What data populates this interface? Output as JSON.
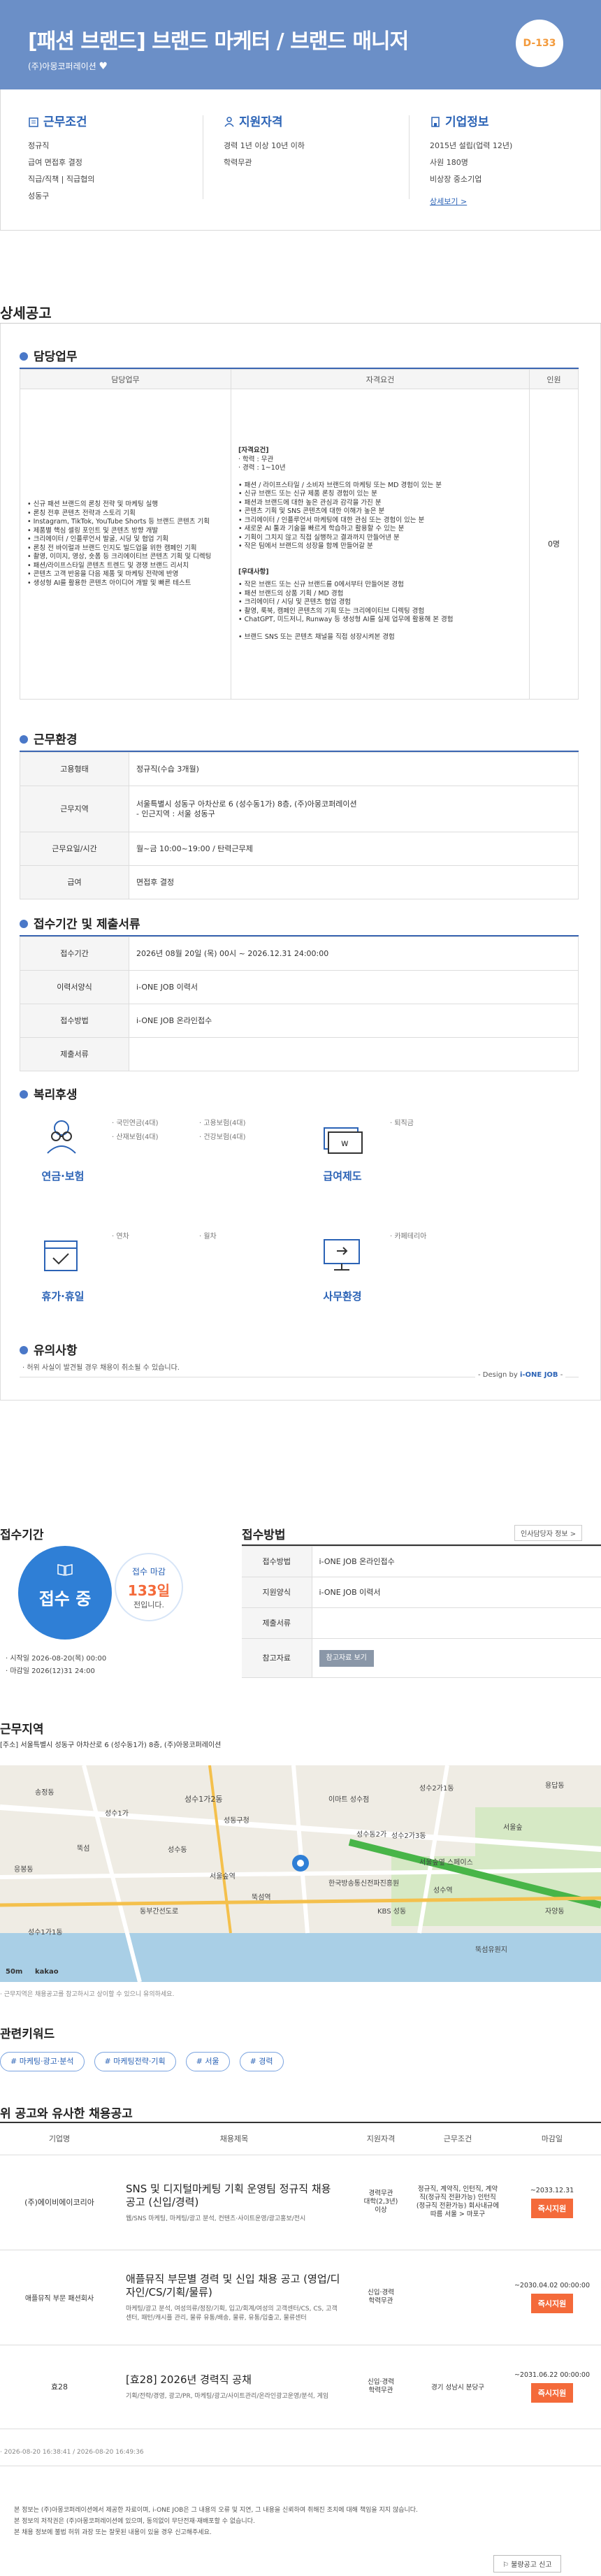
{
  "header": {
    "title": "[패션 브랜드] 브랜드 마케터 / 브랜드 매니저",
    "company": "(주)아몽코퍼레이션",
    "dday": "D-133"
  },
  "info": {
    "conditions": {
      "title": "근무조건",
      "lines": [
        "정규직",
        "급여 면접후 결정",
        "직급/직책 | 직급협의",
        "성동구"
      ]
    },
    "qualifications": {
      "title": "지원자격",
      "lines": [
        "경력 1년 이상 10년 이하",
        "학력무관"
      ]
    },
    "company": {
      "title": "기업정보",
      "lines": [
        "2015년 설립(업력 12년)",
        "사원 180명",
        "비상장 중소기업"
      ],
      "link": "상세보기 >"
    }
  },
  "detail_title": "상세공고",
  "duties": {
    "heading": "담당업무",
    "columns": [
      "담당업무",
      "자격요건",
      "인원"
    ],
    "task_lines": [
      "• 신규 패션 브랜드의 론칭 전략 및 마케팅 실행",
      "• 론칭 전후 콘텐츠 전략과 스토리 기획",
      "• Instagram, TikTok, YouTube Shorts 등 브랜드 콘텐츠 기획",
      "• 제품별 핵심 셀링 포인트 및 콘텐츠 방향 개발",
      "• 크리에이터 / 인플루언서 발굴, 시딩 및 협업 기획",
      "• 론칭 전 바이럴과 브랜드 인지도 빌드업을 위한 캠페인 기획",
      "• 촬영, 이미지, 영상, 숏폼 등 크리에이티브 콘텐츠 기획 및 디렉팅",
      "• 패션/라이프스타일 콘텐츠 트렌드 및 경쟁 브랜드 리서치",
      "• 콘텐츠 고객 반응을 다음 제품 및 마케팅 전략에 반영",
      "• 생성형 AI를 활용한 콘텐츠 아이디어 개발 및 빠른 테스트"
    ],
    "req_title": "[자격요건]",
    "req_lines": [
      "· 학력 : 무관",
      "· 경력 : 1~10년",
      "",
      "• 패션 / 라이프스타일 / 소비자 브랜드의 마케팅 또는 MD 경험이 있는 분",
      "• 신규 브랜드 또는 신규 제품 론칭 경험이 있는 분",
      "• 패션과 브랜드에 대한 높은 관심과 감각을 가진 분",
      "• 콘텐츠 기획 및 SNS 콘텐츠에 대한 이해가 높은 분",
      "• 크리에이터 / 인플루언서 마케팅에 대한 관심 또는 경험이 있는 분",
      "• 새로운 AI 툴과 기술을 빠르게 학습하고 활용할 수 있는 분",
      "• 기획이 그치지 않고 직접 실행하고 결과까지 만들어낸 분",
      "• 작은 팀에서 브랜드의 성장을 함께 만들어갈 분"
    ],
    "pref_title": "[우대사항]",
    "pref_lines": [
      "• 작은 브랜드 또는 신규 브랜드를 0에서부터 만들어본 경험",
      "• 패션 브랜드의 상품 기획 / MD 경험",
      "• 크리에이터 / 시딩 및 콘텐츠 협업 경험",
      "• 촬영, 룩북, 캠페인 콘텐츠의 기획 또는 크리에이티브 디렉팅 경험",
      "• ChatGPT, 미드저니, Runway 등 생성형 AI를 실제 업무에 활용해 본 경험",
      "",
      "• 브랜드 SNS 또는 콘텐츠 채널을 직접 성장시켜본 경험"
    ],
    "headcount": "0명"
  },
  "work": {
    "heading": "근무환경",
    "rows": [
      {
        "label": "고용형태",
        "value": "정규직(수습 3개월)"
      },
      {
        "label": "근무지역",
        "value": "서울특별시 성동구 아차산로 6 (성수동1가) 8층, (주)아몽코퍼레이션\n- 인근지역 : 서울 성동구"
      },
      {
        "label": "근무요일/시간",
        "value": "월~금 10:00~19:00 / 탄력근무제"
      },
      {
        "label": "급여",
        "value": "면접후 결정"
      }
    ]
  },
  "apply": {
    "heading": "접수기간 및 제출서류",
    "rows": [
      {
        "label": "접수기간",
        "value": "2026년 08월 20일 (목) 00시 ~ 2026.12.31 24:00:00"
      },
      {
        "label": "이력서양식",
        "value": "i-ONE JOB 이력서"
      },
      {
        "label": "접수방법",
        "value": "i-ONE JOB 온라인접수"
      },
      {
        "label": "제출서류",
        "value": ""
      }
    ]
  },
  "benefits": {
    "heading": "복리후생",
    "groups": [
      {
        "name": "연금·보험",
        "icon": "glasses-person-icon",
        "items": [
          "· 국민연금(4대)",
          "· 고용보험(4대)",
          "· 산재보험(4대)",
          "· 건강보험(4대)"
        ]
      },
      {
        "name": "급여제도",
        "icon": "money-icon",
        "items": [
          "· 퇴직금"
        ]
      },
      {
        "name": "휴가·휴일",
        "icon": "calendar-icon",
        "items": [
          "· 연차",
          "· 월차"
        ]
      },
      {
        "name": "사무환경",
        "icon": "monitor-icon",
        "items": [
          "· 카페테리아"
        ]
      }
    ]
  },
  "notice": {
    "heading": "유의사항",
    "text": "· 허위 사실이 발견될 경우 채용이 취소될 수 있습니다.",
    "design_prefix": "- Design by ",
    "design_brand": "i-ONE JOB",
    "design_suffix": " -"
  },
  "period": {
    "heading": "접수기간",
    "status": "접수 중",
    "deadline_label": "접수 마감",
    "deadline_days": "133일",
    "deadline_suffix": "전입니다.",
    "start": "· 시작일 2026-08-20(목) 00:00",
    "end": "· 마감일 2026(12)31 24:00"
  },
  "method": {
    "heading": "접수방법",
    "pill": "인사담당자 정보  >",
    "rows": [
      {
        "label": "접수방법",
        "value": "i-ONE JOB 온라인접수"
      },
      {
        "label": "지원양식",
        "value": "i-ONE JOB 이력서"
      },
      {
        "label": "제출서류",
        "value": ""
      },
      {
        "label": "참고자료",
        "value": "참고자료 보기"
      }
    ]
  },
  "location": {
    "heading": "근무지역",
    "address": "[주소] 서울특별시 성동구 아차산로 6 (성수동1가) 8층, (주)아몽코퍼레이션",
    "note": "· 근무지역은 채용공고를 참고하시고 상이할 수 있으니 유의하세요.",
    "map": {
      "labels": [
        "성수1가2동",
        "성수1가1동",
        "성수2가1동",
        "성수2가3동",
        "성수동",
        "뚝섬역",
        "성수역",
        "서울숲",
        "서울숲역",
        "성동구청",
        "한국방송통신전파진흥원",
        "이마트 성수점",
        "성수1가",
        "송정동",
        "용답동",
        "성수동2가",
        "자양동",
        "뚝섬유원지",
        "동부간선도로",
        "KBS 성동",
        "응봉동",
        "뚝섬",
        "서울숲옆 스페이스"
      ],
      "scale": "50m",
      "brand": "kakao"
    }
  },
  "keywords": {
    "heading": "관련키워드",
    "items": [
      "# 마케팅·광고·분석",
      "# 마케팅전략·기획",
      "# 서울",
      "# 경력"
    ]
  },
  "similar": {
    "heading": "위 공고와 유사한 채용공고",
    "columns": [
      "기업명",
      "채용제목",
      "지원자격",
      "근무조건",
      "마감일"
    ],
    "rows": [
      {
        "company": "(주)에이비에이코리아",
        "title": "SNS 및 디지털마케팅 기획 운영팀 정규직 채용 공고 (신입/경력)",
        "tags": "웹/SNS 마케팅, 마케팅/광고 분석, 컨텐츠·사이트운영/광고홍보/전시",
        "qual": "경력무관\n대학(2,3년)\n이상",
        "cond": "정규직, 계약직, 인턴직, 계약직(정규직 전환가능) 인턴직(정규직 전환가능) 회사내규에 따름 서울 > 마포구",
        "deadline": "~2033.12.31",
        "btn": "즉시지원"
      },
      {
        "company": "애플뮤직 부문 패션회사",
        "title": "애플뮤직 부문별 경력 및 신입 채용 공고 (영업/디자인/CS/기획/물류)",
        "tags": "마케팅/광고 분석, 여성의류/정장/기획, 입고/회계/여성의 고객센터/CS, CS, 고객센터, 패턴/캐시플 관리, 물류 유통/배송, 물류, 유통/입출고, 물류센터",
        "qual": "신입·경력\n학력무관",
        "cond": "",
        "deadline": "~2030.04.02 00:00:00",
        "btn": "즉시지원"
      },
      {
        "company": "효28",
        "title": "[효28] 2026년 경력직 공채",
        "tags": "기획/전략/경영, 광고/PR, 마케팅/광고/사이트관리/온라인광고운영/분석, 게임",
        "qual": "신입·경력\n학력무관",
        "cond": "경기 성남시 분당구",
        "deadline": "~2031.06.22 00:00:00",
        "btn": "즉시지원"
      }
    ]
  },
  "timestamp": "· 2026-08-20 16:38:41 / 2026-08-20 16:49:36",
  "footer": {
    "lines": [
      "본 정보는 (주)아몽코퍼레이션에서 제공한 자료이며, i-ONE JOB은 그 내용의 오류 및 지연, 그 내용을 신뢰하여 취해진 조치에 대해 책임을 지지 않습니다.",
      "본 정보의 저작권은 (주)아몽코퍼레이션에 있으며, 동의없이 무단전재·재배포할 수 없습니다.",
      "본 채용 정보에 불법 허위 과장 또는 잘못된 내용이 있을 경우 신고해주세요."
    ],
    "report": "불량공고 신고"
  }
}
